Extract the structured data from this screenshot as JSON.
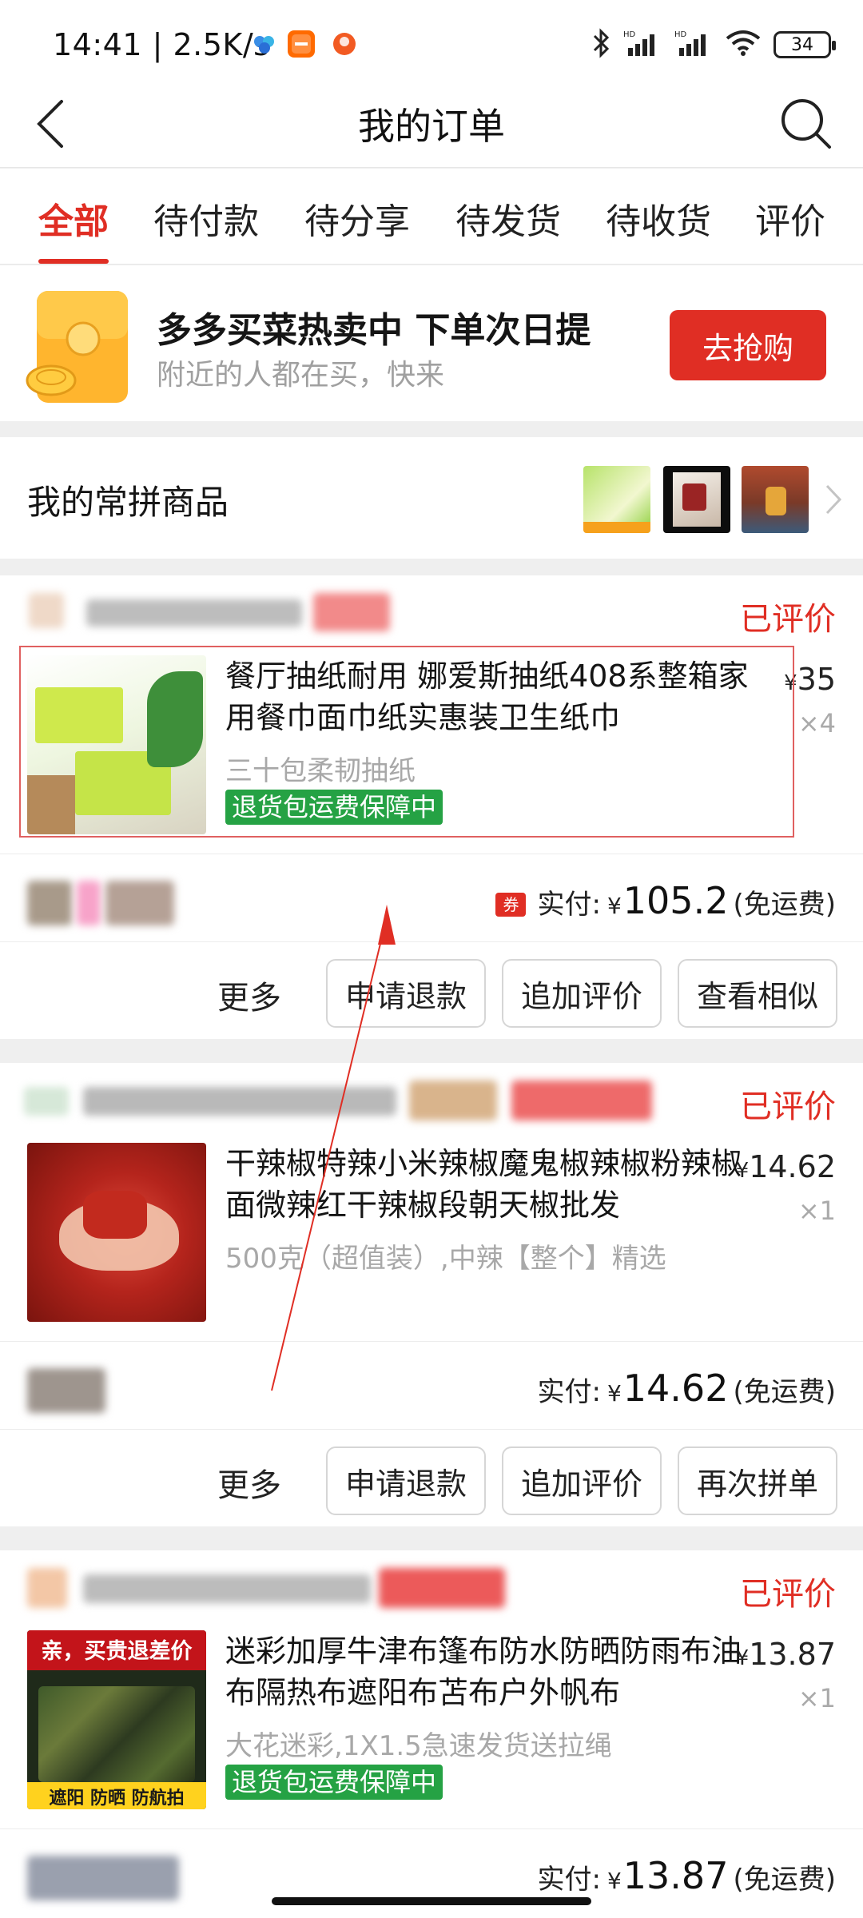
{
  "status_bar": {
    "time": "14:41",
    "net_speed": "| 2.5K/s",
    "battery": "34"
  },
  "header": {
    "title": "我的订单",
    "back_icon": "chevron-left-icon",
    "search_icon": "search-icon"
  },
  "tabs": [
    {
      "label": "全部",
      "active": true
    },
    {
      "label": "待付款",
      "active": false
    },
    {
      "label": "待分享",
      "active": false
    },
    {
      "label": "待发货",
      "active": false
    },
    {
      "label": "待收货",
      "active": false
    },
    {
      "label": "评价",
      "active": false
    }
  ],
  "promo": {
    "title": "多多买菜热卖中 下单次日提",
    "subtitle": "附近的人都在买，快来",
    "button": "去抢购"
  },
  "frequent": {
    "label": "我的常拼商品"
  },
  "orders": [
    {
      "status": "已评价",
      "title": "餐厅抽纸耐用 娜爱斯抽纸408系整箱家用餐巾面巾纸实惠装卫生纸巾",
      "spec": "三十包柔韧抽纸",
      "guarantee": "退货包运费保障中",
      "price": "35",
      "qty": "×4",
      "pay_label": "实付:",
      "pay_amount": "105.2",
      "pay_note": "(免运费)",
      "coupon": "券",
      "more": "更多",
      "buttons": [
        "申请退款",
        "追加评价",
        "查看相似"
      ]
    },
    {
      "status": "已评价",
      "title": "干辣椒特辣小米辣椒魔鬼椒辣椒粉辣椒面微辣红干辣椒段朝天椒批发",
      "spec": "500克（超值装）,中辣【整个】精选",
      "price": "14.62",
      "qty": "×1",
      "pay_label": "实付:",
      "pay_amount": "14.62",
      "pay_note": "(免运费)",
      "more": "更多",
      "buttons": [
        "申请退款",
        "追加评价",
        "再次拼单"
      ]
    },
    {
      "status": "已评价",
      "title": "迷彩加厚牛津布篷布防水防晒防雨布油布隔热布遮阳布苫布户外帆布",
      "spec": "大花迷彩,1X1.5急速发货送拉绳",
      "guarantee": "退货包运费保障中",
      "price": "13.87",
      "qty": "×1",
      "pay_label": "实付:",
      "pay_amount": "13.87",
      "pay_note": "(免运费)",
      "image_text_top": "亲，买贵退差价",
      "image_text_bottom": "遮阳 防晒 防航拍"
    }
  ],
  "currency": "¥",
  "colors": {
    "accent": "#e02e24",
    "guarantee": "#25a244"
  }
}
